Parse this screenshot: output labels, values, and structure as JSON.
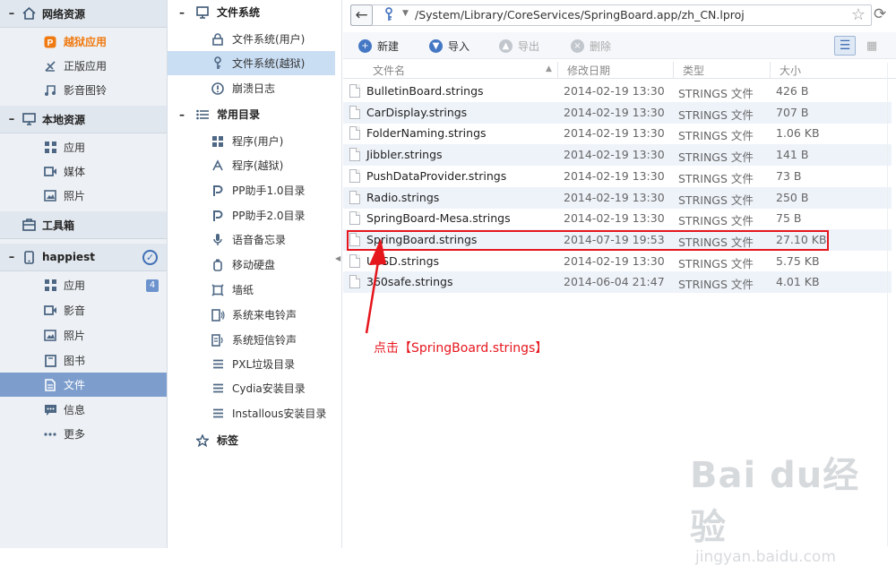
{
  "left_nav": {
    "network_section": {
      "label": "网络资源",
      "items": [
        {
          "label": "越狱应用",
          "icon": "pp-icon"
        },
        {
          "label": "正版应用",
          "icon": "ruler-icon"
        },
        {
          "label": "影音图铃",
          "icon": "music-icon"
        }
      ]
    },
    "local_section": {
      "label": "本地资源",
      "items": [
        {
          "label": "应用",
          "icon": "apps-grid-icon"
        },
        {
          "label": "媒体",
          "icon": "video-icon"
        },
        {
          "label": "照片",
          "icon": "photo-icon"
        }
      ]
    },
    "toolbox": {
      "label": "工具箱",
      "icon": "toolbox-icon"
    },
    "device_section": {
      "label": "happiest",
      "items": [
        {
          "label": "应用",
          "icon": "apps-grid-icon",
          "badge": "4"
        },
        {
          "label": "影音",
          "icon": "video-icon"
        },
        {
          "label": "照片",
          "icon": "photo-icon"
        },
        {
          "label": "图书",
          "icon": "book-icon"
        },
        {
          "label": "文件",
          "icon": "file-icon",
          "selected": true
        },
        {
          "label": "信息",
          "icon": "message-icon"
        },
        {
          "label": "更多",
          "icon": "more-icon"
        }
      ]
    }
  },
  "middle_nav": {
    "filesystem_section": {
      "label": "文件系统",
      "items": [
        {
          "label": "文件系统(用户)",
          "icon": "lock-icon"
        },
        {
          "label": "文件系统(越狱)",
          "icon": "key-icon",
          "selected": true
        },
        {
          "label": "崩溃日志",
          "icon": "alert-icon"
        }
      ]
    },
    "common_section": {
      "label": "常用目录",
      "items": [
        {
          "label": "程序(用户)",
          "icon": "apps-grid-icon"
        },
        {
          "label": "程序(越狱)",
          "icon": "app-store-icon"
        },
        {
          "label": "PP助手1.0目录",
          "icon": "pp-icon"
        },
        {
          "label": "PP助手2.0目录",
          "icon": "pp-icon"
        },
        {
          "label": "语音备忘录",
          "icon": "mic-icon"
        },
        {
          "label": "移动硬盘",
          "icon": "usb-icon"
        },
        {
          "label": "墙纸",
          "icon": "wallpaper-icon"
        },
        {
          "label": "系统来电铃声",
          "icon": "ringtone-icon"
        },
        {
          "label": "系统短信铃声",
          "icon": "sms-ringtone-icon"
        },
        {
          "label": "PXL垃圾目录",
          "icon": "list-icon"
        },
        {
          "label": "Cydia安装目录",
          "icon": "list-icon"
        },
        {
          "label": "Installous安装目录",
          "icon": "list-icon"
        }
      ]
    },
    "tags_section": {
      "label": "标签",
      "icon": "star-icon"
    }
  },
  "address_bar": {
    "path": "/System/Library/CoreServices/SpringBoard.app/zh_CN.lproj"
  },
  "toolbar": {
    "new_label": "新建",
    "import_label": "导入",
    "export_label": "导出",
    "delete_label": "删除"
  },
  "file_table": {
    "columns": [
      "文件名",
      "修改日期",
      "类型",
      "大小"
    ],
    "rows": [
      {
        "name": "BulletinBoard.strings",
        "date": "2014-02-19 13:30",
        "type": "STRINGS 文件",
        "size": "426 B"
      },
      {
        "name": "CarDisplay.strings",
        "date": "2014-02-19 13:30",
        "type": "STRINGS 文件",
        "size": "707 B"
      },
      {
        "name": "FolderNaming.strings",
        "date": "2014-02-19 13:30",
        "type": "STRINGS 文件",
        "size": "1.06 KB"
      },
      {
        "name": "Jibbler.strings",
        "date": "2014-02-19 13:30",
        "type": "STRINGS 文件",
        "size": "141 B"
      },
      {
        "name": "PushDataProvider.strings",
        "date": "2014-02-19 13:30",
        "type": "STRINGS 文件",
        "size": "73 B"
      },
      {
        "name": "Radio.strings",
        "date": "2014-02-19 13:30",
        "type": "STRINGS 文件",
        "size": "250 B"
      },
      {
        "name": "SpringBoard-Mesa.strings",
        "date": "2014-02-19 13:30",
        "type": "STRINGS 文件",
        "size": "75 B"
      },
      {
        "name": "SpringBoard.strings",
        "date": "2014-07-19 19:53",
        "type": "STRINGS 文件",
        "size": "27.10 KB"
      },
      {
        "name": "USSD.strings",
        "date": "2014-02-19 13:30",
        "type": "STRINGS 文件",
        "size": "5.75 KB"
      },
      {
        "name": "360safe.strings",
        "date": "2014-06-04 21:47",
        "type": "STRINGS 文件",
        "size": "4.01 KB"
      }
    ]
  },
  "annotation": {
    "text": "点击【SpringBoard.strings】",
    "color": "#e6161d"
  },
  "watermark": {
    "line1": "Bai du经验",
    "line2": "jingyan.baidu.com"
  }
}
